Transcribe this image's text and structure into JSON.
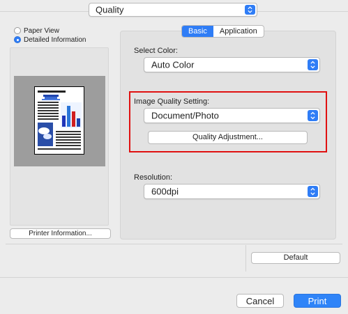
{
  "top_popup": {
    "value": "Quality"
  },
  "view_options": [
    {
      "label": "Paper View",
      "selected": false
    },
    {
      "label": "Detailed Information",
      "selected": true
    }
  ],
  "buttons": {
    "printer_info": "Printer Information...",
    "default": "Default",
    "cancel": "Cancel",
    "print": "Print"
  },
  "tabs": [
    {
      "label": "Basic",
      "active": true
    },
    {
      "label": "Application",
      "active": false
    }
  ],
  "select_color": {
    "label": "Select Color:",
    "value": "Auto Color"
  },
  "image_quality": {
    "label": "Image Quality Setting:",
    "value": "Document/Photo",
    "adjust_button": "Quality Adjustment..."
  },
  "resolution": {
    "label": "Resolution:",
    "value": "600dpi"
  },
  "colors": {
    "accent": "#2f7df6",
    "highlight": "#e01010"
  }
}
